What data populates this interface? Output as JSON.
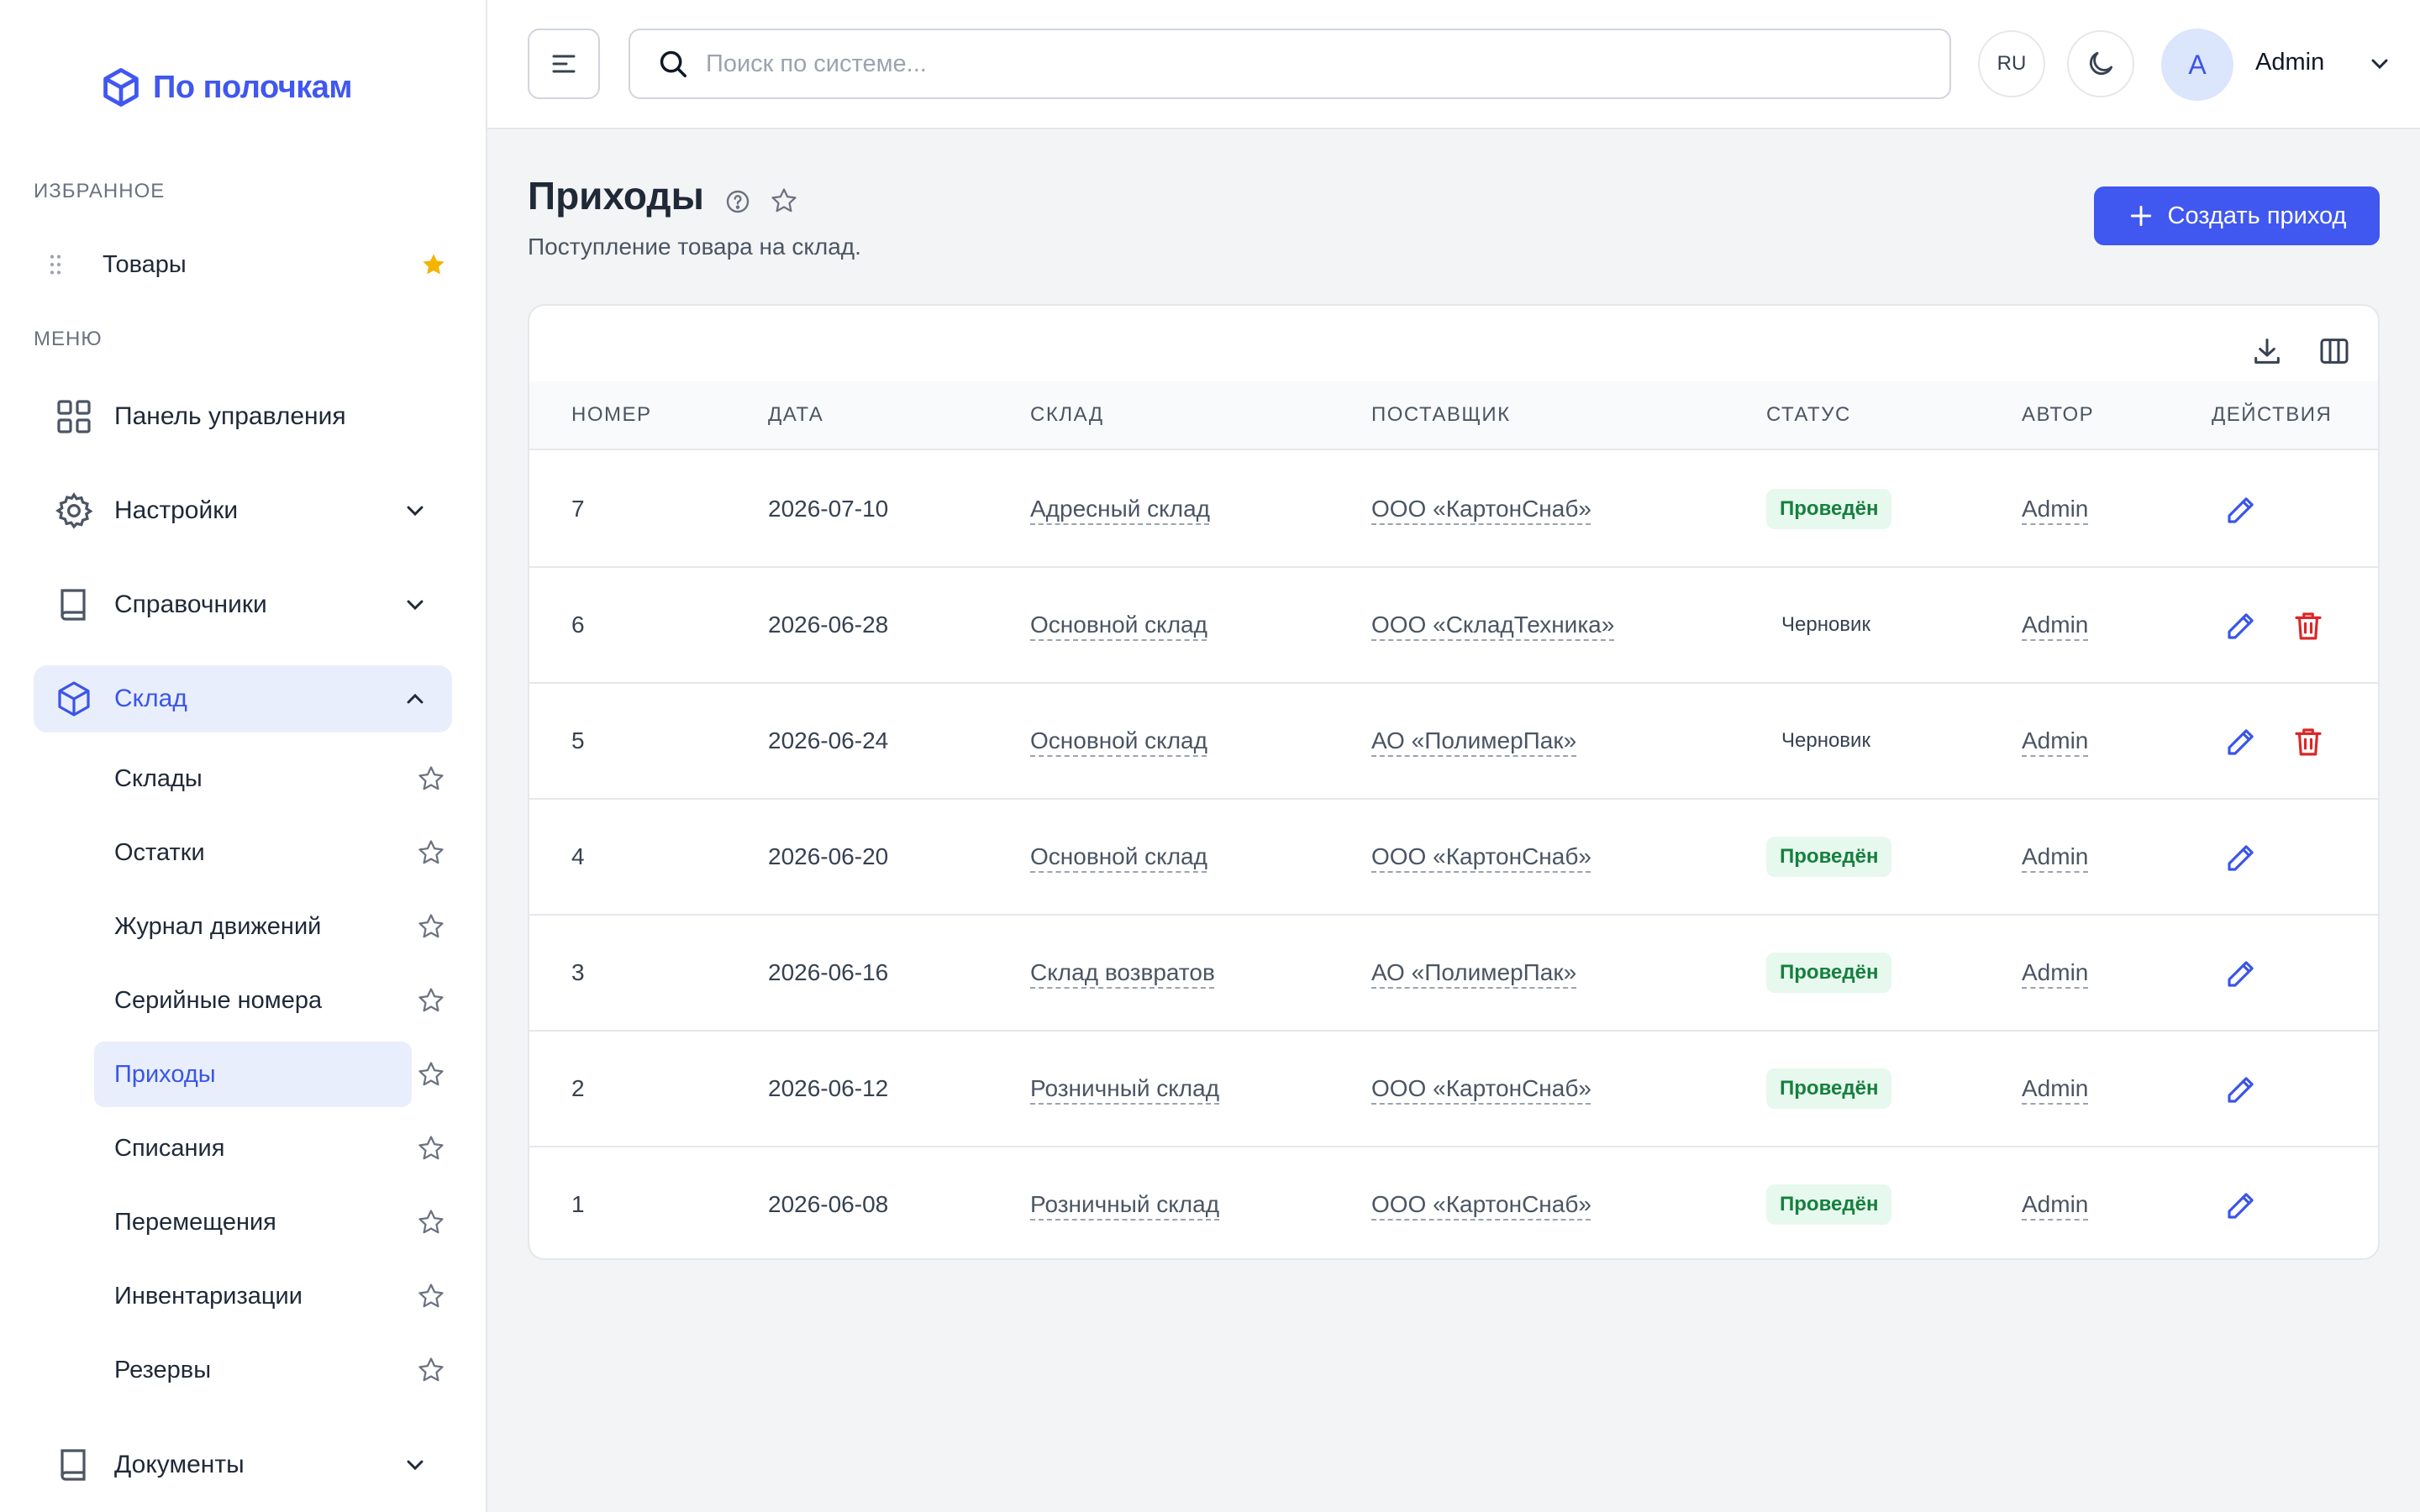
{
  "brand": {
    "name": "По полочкам",
    "color": "#4057f0"
  },
  "sidebar": {
    "favorites_label": "ИЗБРАННОЕ",
    "favorites": [
      {
        "label": "Товары",
        "icon": "star-filled-icon"
      }
    ],
    "menu_label": "МЕНЮ",
    "menu": [
      {
        "label": "Панель управления",
        "icon": "grid-icon"
      },
      {
        "label": "Настройки",
        "icon": "gear-icon"
      },
      {
        "label": "Справочники",
        "icon": "book-icon"
      },
      {
        "label": "Склад",
        "icon": "box-icon"
      },
      {
        "label": "Документы",
        "icon": "book-icon"
      }
    ],
    "warehouse_sub": [
      {
        "label": "Склады"
      },
      {
        "label": "Остатки"
      },
      {
        "label": "Журнал движений"
      },
      {
        "label": "Серийные номера"
      },
      {
        "label": "Приходы"
      },
      {
        "label": "Списания"
      },
      {
        "label": "Перемещения"
      },
      {
        "label": "Инвентаризации"
      },
      {
        "label": "Резервы"
      }
    ]
  },
  "header": {
    "search_placeholder": "Поиск по системе...",
    "lang": "RU",
    "avatar_letter": "A",
    "user_name": "Admin"
  },
  "page": {
    "title": "Приходы",
    "subtitle": "Поступление товара на склад.",
    "create_label": "Создать приход"
  },
  "table": {
    "columns": [
      "НОМЕР",
      "ДАТА",
      "СКЛАД",
      "ПОСТАВЩИК",
      "СТАТУС",
      "АВТОР",
      "ДЕЙСТВИЯ"
    ],
    "rows": [
      {
        "num": "7",
        "date": "2026-07-10",
        "warehouse": "Адресный склад",
        "supplier": "ООО «КартонСнаб»",
        "status": "Проведён",
        "status_type": "done",
        "author": "Admin",
        "can_delete": false
      },
      {
        "num": "6",
        "date": "2026-06-28",
        "warehouse": "Основной склад",
        "supplier": "ООО «СкладТехника»",
        "status": "Черновик",
        "status_type": "draft",
        "author": "Admin",
        "can_delete": true
      },
      {
        "num": "5",
        "date": "2026-06-24",
        "warehouse": "Основной склад",
        "supplier": "АО «ПолимерПак»",
        "status": "Черновик",
        "status_type": "draft",
        "author": "Admin",
        "can_delete": true
      },
      {
        "num": "4",
        "date": "2026-06-20",
        "warehouse": "Основной склад",
        "supplier": "ООО «КартонСнаб»",
        "status": "Проведён",
        "status_type": "done",
        "author": "Admin",
        "can_delete": false
      },
      {
        "num": "3",
        "date": "2026-06-16",
        "warehouse": "Склад возвратов",
        "supplier": "АО «ПолимерПак»",
        "status": "Проведён",
        "status_type": "done",
        "author": "Admin",
        "can_delete": false
      },
      {
        "num": "2",
        "date": "2026-06-12",
        "warehouse": "Розничный склад",
        "supplier": "ООО «КартонСнаб»",
        "status": "Проведён",
        "status_type": "done",
        "author": "Admin",
        "can_delete": false
      },
      {
        "num": "1",
        "date": "2026-06-08",
        "warehouse": "Розничный склад",
        "supplier": "ООО «КартонСнаб»",
        "status": "Проведён",
        "status_type": "done",
        "author": "Admin",
        "can_delete": false
      }
    ]
  },
  "colors": {
    "accent": "#4057f0",
    "success_text": "#15803d",
    "success_bg": "#e7f8ee",
    "danger": "#dc2626",
    "star": "#f4b400"
  }
}
